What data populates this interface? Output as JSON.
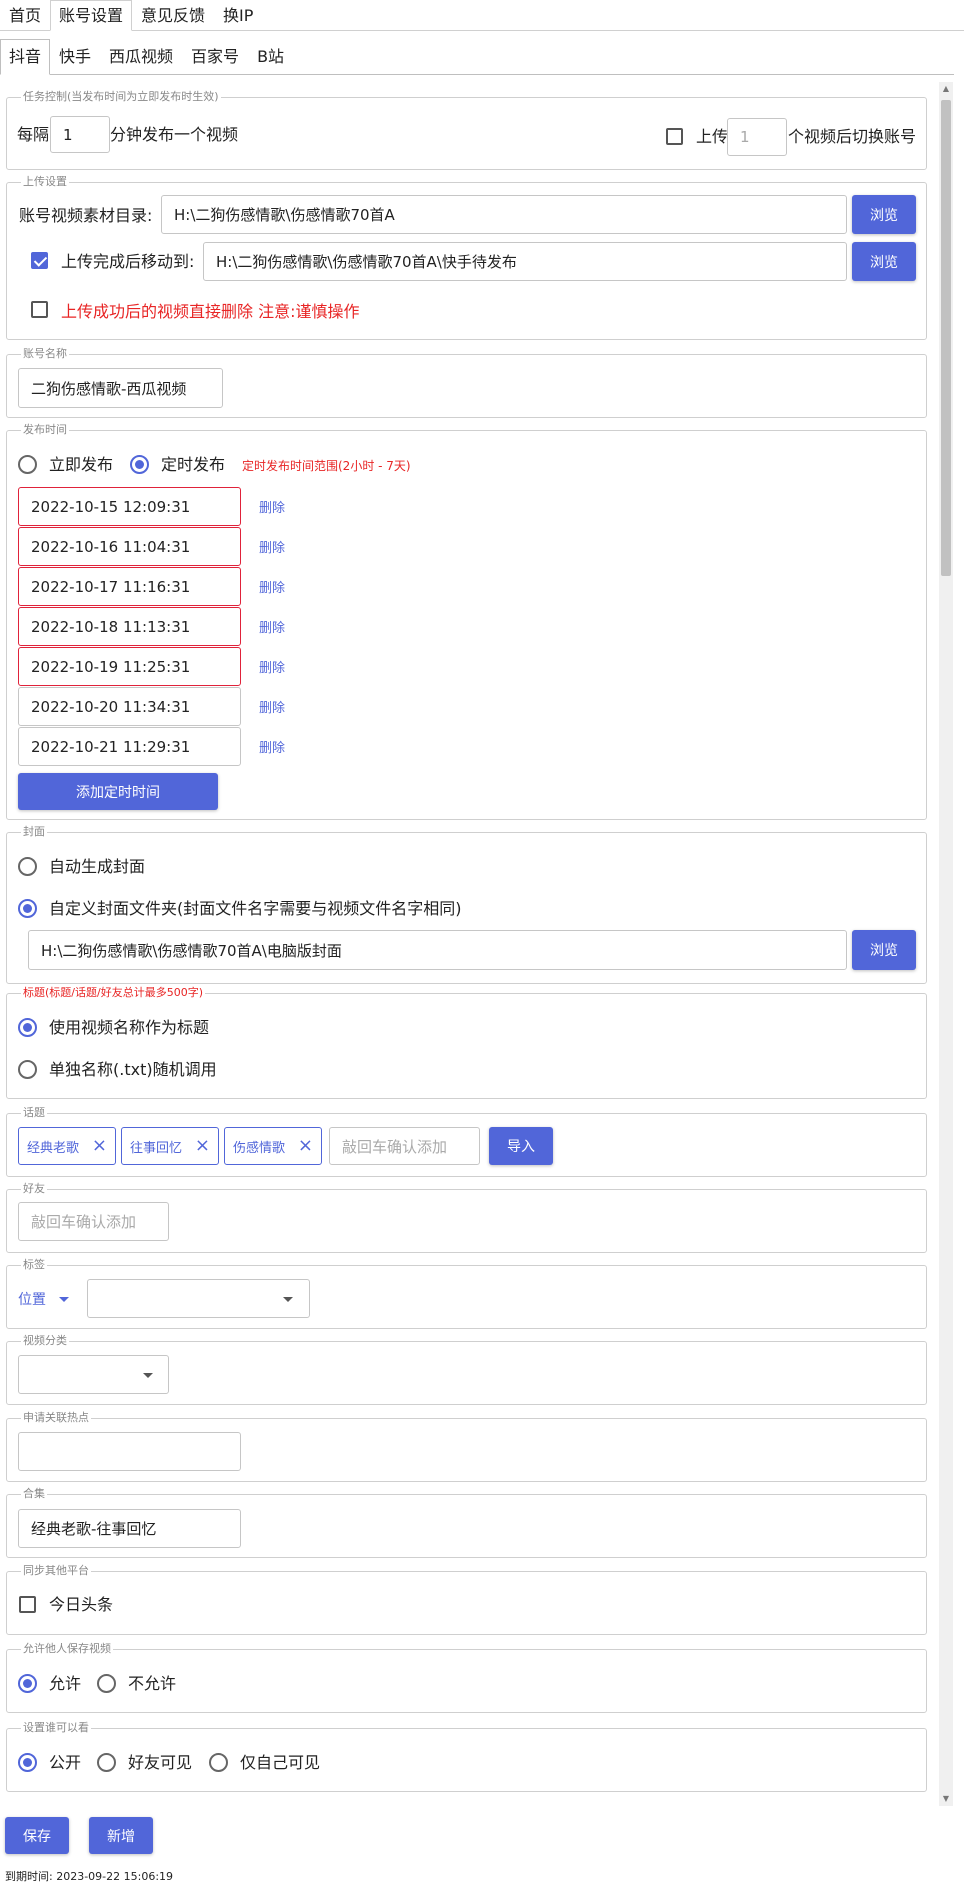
{
  "top_tabs": [
    "首页",
    "账号设置",
    "意见反馈",
    "换IP"
  ],
  "sub_tabs": [
    "抖音",
    "快手",
    "西瓜视频",
    "百家号",
    "B站"
  ],
  "task_control": {
    "legend": "任务控制(当发布时间为立即发布时生效)",
    "every_label": "每隔",
    "minutes_value": "1",
    "minutes_suffix": "分钟发布一个视频",
    "upload_label": "上传",
    "switch_count_placeholder": "1",
    "switch_suffix": "个视频后切换账号"
  },
  "upload": {
    "legend": "上传设置",
    "dir_label": "账号视频素材目录:",
    "dir_value": "H:\\二狗伤感情歌\\伤感情歌70首A",
    "browse": "浏览",
    "move_label": "上传完成后移动到:",
    "move_value": "H:\\二狗伤感情歌\\伤感情歌70首A\\快手待发布",
    "delete_label": "上传成功后的视频直接删除 注意:谨慎操作"
  },
  "account": {
    "legend": "账号名称",
    "value": "二狗伤感情歌-西瓜视频"
  },
  "publish": {
    "legend": "发布时间",
    "immediate": "立即发布",
    "scheduled": "定时发布",
    "range_note": "定时发布时间范围(2小时 - 7天)",
    "times": [
      "2022-10-15 12:09:31",
      "2022-10-16 11:04:31",
      "2022-10-17 11:16:31",
      "2022-10-18 11:13:31",
      "2022-10-19 11:25:31",
      "2022-10-20 11:34:31",
      "2022-10-21 11:29:31"
    ],
    "delete": "删除",
    "add_button": "添加定时时间"
  },
  "cover": {
    "legend": "封面",
    "auto": "自动生成封面",
    "custom": "自定义封面文件夹(封面文件名字需要与视频文件名字相同)",
    "path": "H:\\二狗伤感情歌\\伤感情歌70首A\\电脑版封面",
    "browse": "浏览"
  },
  "title": {
    "legend": "标题(标题/话题/好友总计最多500字)",
    "use_video_name": "使用视频名称作为标题",
    "random_txt": "单独名称(.txt)随机调用"
  },
  "topic": {
    "legend": "话题",
    "chips": [
      "经典老歌",
      "往事回忆",
      "伤感情歌"
    ],
    "placeholder": "敲回车确认添加",
    "import": "导入"
  },
  "friends": {
    "legend": "好友",
    "placeholder": "敲回车确认添加"
  },
  "tag": {
    "legend": "标签",
    "location": "位置"
  },
  "category": {
    "legend": "视频分类"
  },
  "hotspot": {
    "legend": "申请关联热点"
  },
  "collection": {
    "legend": "合集",
    "value": "经典老歌-往事回忆"
  },
  "sync": {
    "legend": "同步其他平台",
    "toutiao": "今日头条"
  },
  "save_video": {
    "legend": "允许他人保存视频",
    "allow": "允许",
    "deny": "不允许"
  },
  "visibility": {
    "legend": "设置谁可以看",
    "public": "公开",
    "friends": "好友可见",
    "private": "仅自己可见"
  },
  "actions": {
    "save": "保存",
    "new": "新增"
  },
  "footer": {
    "expire": "到期时间: 2023-09-22 15:06:19"
  },
  "colors": {
    "accent": "#5166d9",
    "danger": "#e82525"
  }
}
